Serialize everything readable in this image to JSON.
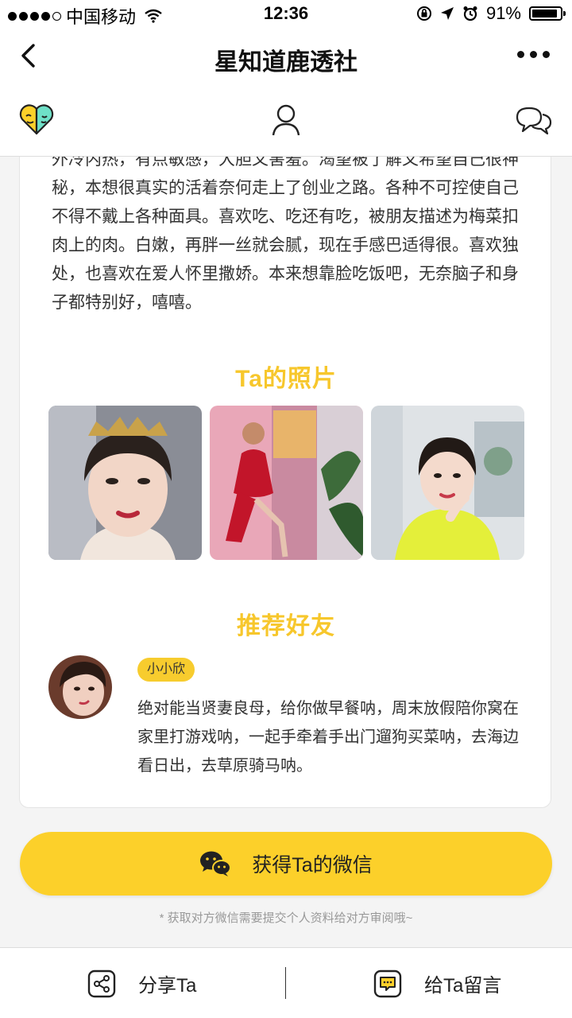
{
  "status_bar": {
    "carrier": "中国移动",
    "time": "12:36",
    "battery": "91%",
    "battery_level": 0.91
  },
  "nav": {
    "title": "星知道鹿透社"
  },
  "profile": {
    "bio": "外冷内热，有点敏感，大胆又害羞。渴望被了解又希望自己很神秘，本想很真实的活着奈何走上了创业之路。各种不可控使自己不得不戴上各种面具。喜欢吃、吃还有吃，被朋友描述为梅菜扣肉上的肉。白嫩，再胖一丝就会腻，现在手感巴适得很。喜欢独处，也喜欢在爱人怀里撒娇。本来想靠脸吃饭吧，无奈脑子和身子都特别好，嘻嘻。"
  },
  "photos": {
    "title": "Ta的照片"
  },
  "recommend": {
    "title": "推荐好友",
    "friend_name": "小小欣",
    "friend_desc": "绝对能当贤妻良母，给你做早餐呐，周末放假陪你窝在家里打游戏呐，一起手牵着手出门遛狗买菜呐，去海边看日出，去草原骑马呐。"
  },
  "cta": {
    "label": "获得Ta的微信",
    "note": "*  获取对方微信需要提交个人资料给对方审阅哦~"
  },
  "bottom_bar": {
    "share": "分享Ta",
    "message": "给Ta留言"
  },
  "colors": {
    "accent": "#fcd02a",
    "title": "#f7c72c"
  }
}
